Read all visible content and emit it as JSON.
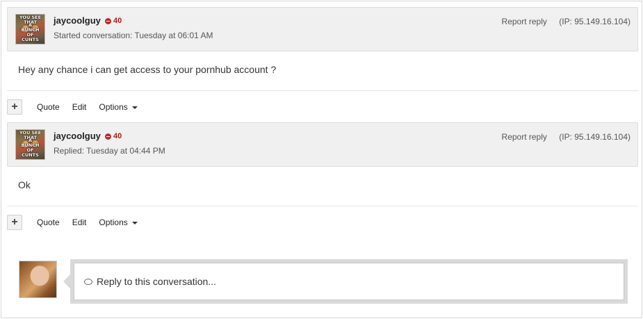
{
  "messages": [
    {
      "username": "jaycoolguy",
      "warning_points": "40",
      "meta": "Started conversation: Tuesday at 06:01 AM",
      "report_label": "Report reply",
      "ip": "(IP: 95.149.16.104)",
      "body": "Hey any chance i can get access to your pornhub account ?",
      "avatar_caption_top": "YOU SEE THAT",
      "avatar_caption_bottom": "A BUNCH OF CUNTS"
    },
    {
      "username": "jaycoolguy",
      "warning_points": "40",
      "meta": "Replied: Tuesday at 04:44 PM",
      "report_label": "Report reply",
      "ip": "(IP: 95.149.16.104)",
      "body": "Ok",
      "avatar_caption_top": "YOU SEE THAT",
      "avatar_caption_bottom": "A BUNCH OF CUNTS"
    }
  ],
  "actions": {
    "plus": "+",
    "quote": "Quote",
    "edit": "Edit",
    "options": "Options"
  },
  "reply": {
    "placeholder": "Reply to this conversation..."
  },
  "colors": {
    "warning": "#b01b1b",
    "header_bg": "#f0f0f0"
  }
}
